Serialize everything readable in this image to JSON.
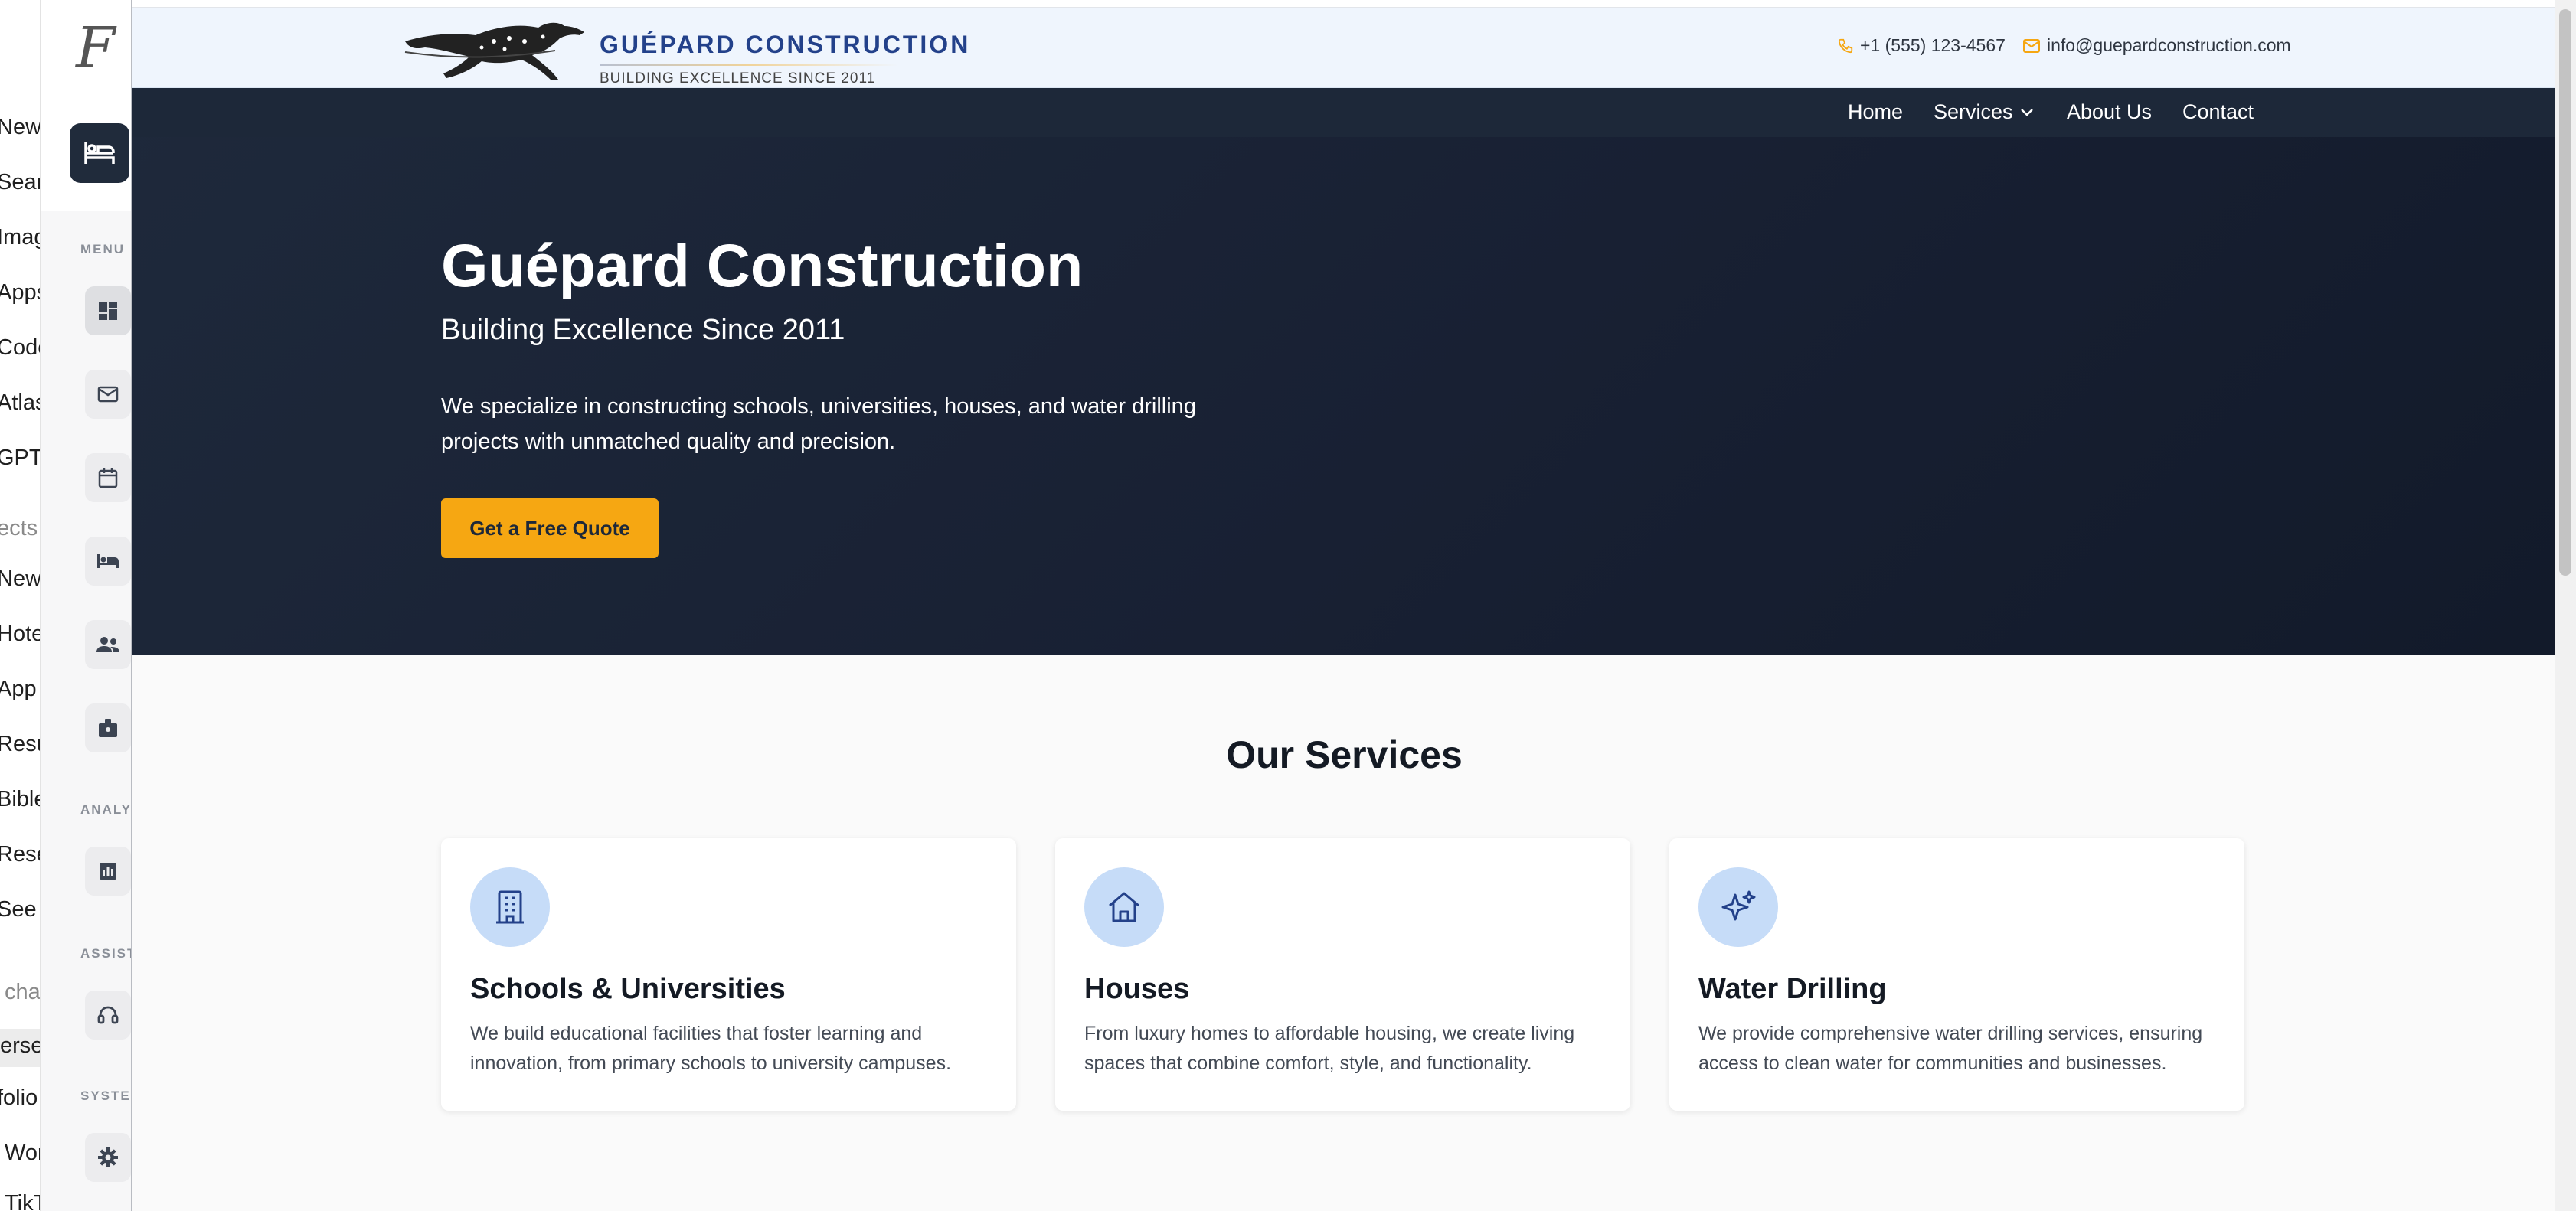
{
  "background_sidebar": {
    "items": [
      "New",
      "Searc",
      "Imag",
      "Apps",
      "Code",
      "Atlas",
      "GPTs",
      "ects",
      "New",
      "Hote",
      "App",
      "Resu",
      "Bible",
      "Rese",
      "See r",
      "cha",
      "ersed",
      "folio",
      "Wor",
      "TikT"
    ]
  },
  "admin_sidebar": {
    "logo": "F",
    "sections": {
      "menu": "MENU",
      "analytics": "ANALY",
      "assistant": "ASSIST",
      "system": "SYSTE"
    },
    "icons": [
      "hotel-icon",
      "dashboard-icon",
      "mail-icon",
      "calendar-icon",
      "bed-icon",
      "people-icon",
      "badge-icon",
      "chart-icon",
      "support-icon",
      "gear-icon"
    ]
  },
  "header": {
    "brand_name": "GUÉPARD CONSTRUCTION",
    "brand_tagline": "BUILDING EXCELLENCE SINCE 2011",
    "phone": "+1 (555) 123-4567",
    "email": "info@guepardconstruction.com"
  },
  "nav": {
    "home": "Home",
    "services": "Services",
    "about": "About Us",
    "contact": "Contact"
  },
  "hero": {
    "title": "Guépard Construction",
    "subtitle": "Building Excellence Since 2011",
    "description": "We specialize in constructing schools, universities, houses, and water drilling projects with unmatched quality and precision.",
    "cta": "Get a Free Quote"
  },
  "services": {
    "heading": "Our Services",
    "cards": [
      {
        "icon": "building-icon",
        "title": "Schools & Universities",
        "description": "We build educational facilities that foster learning and innovation, from primary schools to university campuses."
      },
      {
        "icon": "house-icon",
        "title": "Houses",
        "description": "From luxury homes to affordable housing, we create living spaces that combine comfort, style, and functionality."
      },
      {
        "icon": "sparkles-icon",
        "title": "Water Drilling",
        "description": "We provide comprehensive water drilling services, ensuring access to clean water for communities and businesses."
      }
    ]
  },
  "colors": {
    "accent": "#f6a712",
    "brand": "#23418a",
    "hero_bg": "#1e293b",
    "icon_circle": "#c6dcf8"
  }
}
